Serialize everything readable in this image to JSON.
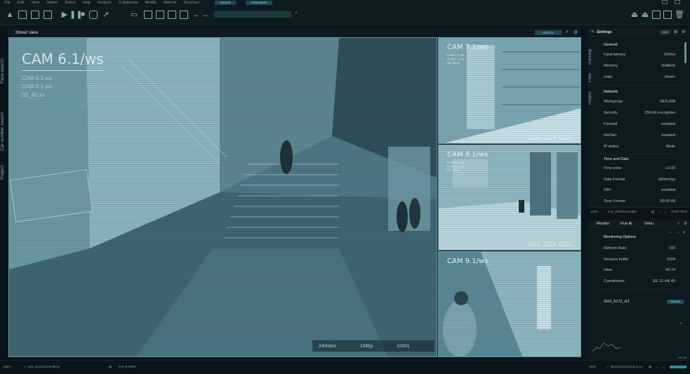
{
  "menu": [
    "File",
    "Edit",
    "View",
    "Option",
    "Select",
    "Help",
    "Analyze",
    "Collaborate",
    "Modify",
    "Add-ins",
    "Structure"
  ],
  "menu_tags": [
    "Search",
    "Extensions"
  ],
  "left_tabs": [
    "Face search",
    "Car number search",
    "Project"
  ],
  "view": {
    "title": "Street view",
    "add_button": "Add cnc"
  },
  "main_cam": {
    "title": "CAM 6.1/ws",
    "lines": [
      "CAM 6.1 ws",
      "CAM 6.1 ws",
      "00_45:xx"
    ],
    "stats": [
      "240mb/s",
      "1080p",
      "10201"
    ]
  },
  "cams": [
    {
      "title": "CAM 7.1/ws",
      "lines": [
        "CAM 7.1 ws",
        "CAM 7.1 ws",
        "00_45:xx"
      ]
    },
    {
      "title": "CAM 8.1/ws",
      "lines": [
        "CAM 8.1 ws",
        "CAM 8.1 ws",
        "00_45:xx"
      ]
    },
    {
      "title": "CAM 9.1/ws",
      "lines": []
    }
  ],
  "settings": {
    "title": "Settings",
    "edit": "Edit",
    "tabs": [
      "Tracking",
      "Files",
      "Project"
    ],
    "general": {
      "heading": "General",
      "rows": [
        {
          "label": "Input latency",
          "value": "100ms"
        },
        {
          "label": "Memory",
          "value": "2048mb"
        },
        {
          "label": "Units",
          "value": "Metric"
        }
      ]
    },
    "network": {
      "heading": "Network",
      "rows": [
        {
          "label": "Workgroup",
          "value": "SES-008"
        },
        {
          "label": "Security",
          "value": "256-bit encryption"
        },
        {
          "label": "Firewall",
          "value": "enabled"
        },
        {
          "label": "AdvSec",
          "value": "enabled"
        },
        {
          "label": "IP status",
          "value": "Static"
        }
      ]
    },
    "time": {
      "heading": "Time and Date",
      "rows": [
        {
          "label": "Time zone",
          "value": "+2.00"
        },
        {
          "label": "Date Format",
          "value": "dd/mm/yy"
        },
        {
          "label": "24H",
          "value": "enabled"
        },
        {
          "label": "Time Format",
          "value": "00:00:00"
        }
      ]
    },
    "footer": {
      "zoom": "125%",
      "file": "test_checklcontroller",
      "counter": "GH/5 HR01"
    }
  },
  "monitor": {
    "tabs": [
      "Monitor",
      "Run AI",
      "Debu"
    ],
    "heading": "Monitoring Options",
    "rows": [
      {
        "label": "Refresh Rate",
        "value": "100"
      },
      {
        "label": "Sensors buffer",
        "value": "1024"
      },
      {
        "label": "View",
        "value": "00.19"
      },
      {
        "label": "Coordinates",
        "value": "EE 12 HK 45"
      }
    ],
    "item": "GH//_5172_HJ",
    "refresh": "Refresh",
    "graph_value": "000.00"
  },
  "status": {
    "zoom": "125%",
    "file": "test_checklcontroller.js",
    "counter": "GH7-8 HR07",
    "zoom_right": "80%",
    "path": "libraries/project/proj.ex"
  }
}
